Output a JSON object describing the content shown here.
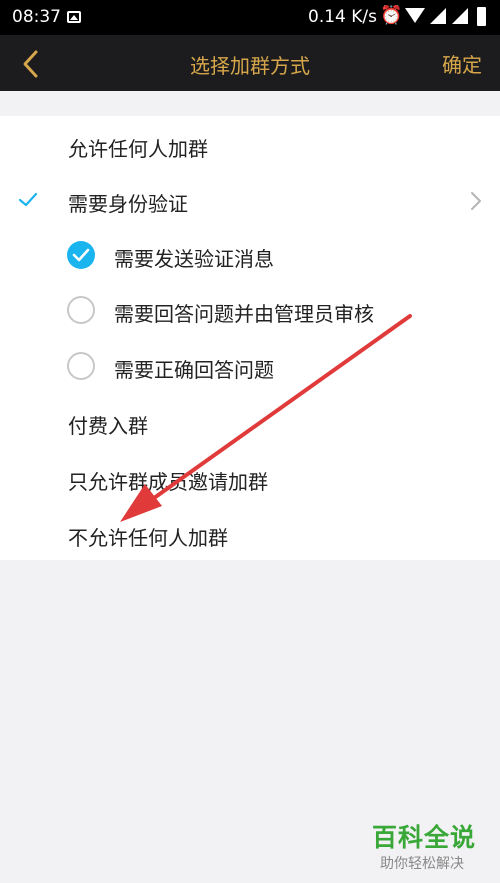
{
  "status_bar": {
    "time": "08:37",
    "speed": "0.14 K/s",
    "icons": [
      "image-icon",
      "alarm-icon",
      "wifi-icon",
      "signal-icon",
      "signal-icon",
      "battery-icon"
    ]
  },
  "nav": {
    "back_icon": "chevron-left-icon",
    "title": "选择加群方式",
    "confirm": "确定",
    "accent_color": "#d6a64b"
  },
  "options": [
    {
      "label": "允许任何人加群",
      "selected": false
    },
    {
      "label": "需要身份验证",
      "selected": true,
      "has_chevron": true
    },
    {
      "label": "需要发送验证消息",
      "sub": true,
      "checked": true
    },
    {
      "label": "需要回答问题并由管理员审核",
      "sub": true,
      "checked": false
    },
    {
      "label": "需要正确回答问题",
      "sub": true,
      "checked": false
    },
    {
      "label": "付费入群",
      "selected": false
    },
    {
      "label": "只允许群成员邀请加群",
      "selected": false
    },
    {
      "label": "不允许任何人加群",
      "selected": false
    }
  ],
  "colors": {
    "check_blue": "#1ab4ef",
    "annotation_arrow": "#e03a3a"
  },
  "watermark": {
    "title": "百科全说",
    "subtitle": "助你轻松解决"
  }
}
